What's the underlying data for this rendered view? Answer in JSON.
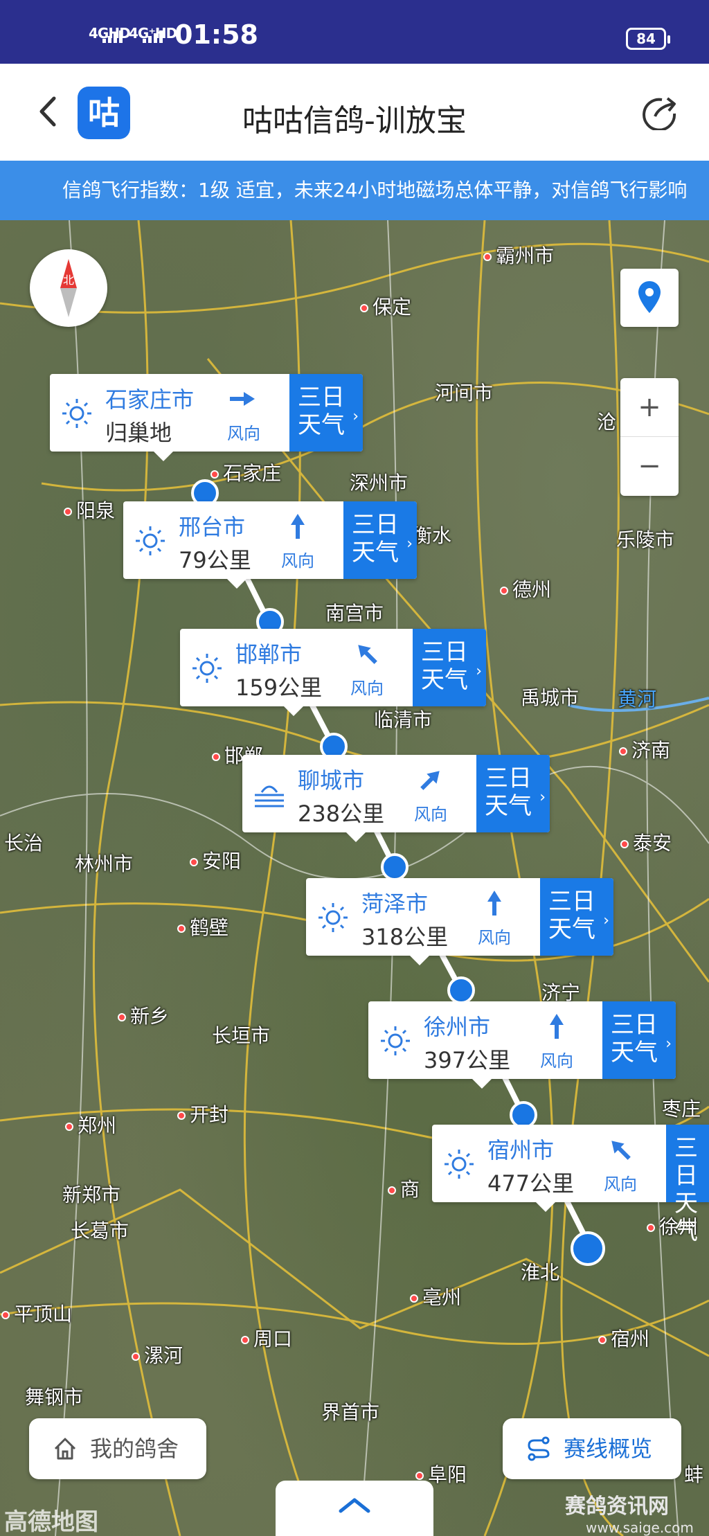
{
  "status_bar": {
    "signal1": "4GHD",
    "signal2": "4G⁺HD",
    "time": "01:58",
    "battery": "84"
  },
  "header": {
    "logo_char": "咕",
    "title": "咕咕信鸽-训放宝"
  },
  "banner": {
    "text": "信鸽飞行指数：1级 适宜，未来24小时地磁场总体平静，对信鸽飞行影响"
  },
  "map": {
    "compass_label": "北",
    "zoom_in": "+",
    "zoom_out": "−",
    "cities": [
      "霸州市",
      "保定",
      "河间市",
      "沧",
      "石家庄",
      "深州市",
      "阳泉",
      "衡水",
      "乐陵市",
      "德州",
      "南宫市",
      "禹城市",
      "黄河",
      "临清市",
      "济南",
      "邯郸",
      "长治",
      "林州市",
      "安阳",
      "泰安",
      "鹤壁",
      "济宁",
      "新乡",
      "长垣市",
      "郑州",
      "开封",
      "枣庄",
      "新郑市",
      "商",
      "长葛市",
      "淮北",
      "徐州",
      "亳州",
      "平顶山",
      "周口",
      "宿州",
      "漯河",
      "舞钢市",
      "界首市",
      "阜阳",
      "蚌"
    ],
    "watermark": "高德地图"
  },
  "route": [
    {
      "icon": "sunny-icon",
      "name": "石家庄市",
      "dist": "归巢地",
      "wind": "风向",
      "btn1": "三日",
      "btn2": "天气"
    },
    {
      "icon": "sunny-icon",
      "name": "邢台市",
      "dist": "79公里",
      "wind": "风向",
      "btn1": "三日",
      "btn2": "天气"
    },
    {
      "icon": "sunny-icon",
      "name": "邯郸市",
      "dist": "159公里",
      "wind": "风向",
      "btn1": "三日",
      "btn2": "天气"
    },
    {
      "icon": "haze-icon",
      "name": "聊城市",
      "dist": "238公里",
      "wind": "风向",
      "btn1": "三日",
      "btn2": "天气"
    },
    {
      "icon": "sunny-icon",
      "name": "菏泽市",
      "dist": "318公里",
      "wind": "风向",
      "btn1": "三日",
      "btn2": "天气"
    },
    {
      "icon": "sunny-icon",
      "name": "徐州市",
      "dist": "397公里",
      "wind": "风向",
      "btn1": "三日",
      "btn2": "天气"
    },
    {
      "icon": "sunny-icon",
      "name": "宿州市",
      "dist": "477公里",
      "wind": "风向",
      "btn1": "三日",
      "btn2": "天气"
    }
  ],
  "bottom": {
    "loft_label": "我的鸽舍",
    "overview_label": "赛线概览"
  },
  "site_watermark": {
    "line1": "赛鸽资讯网",
    "line2": "www.saige.com"
  },
  "colors": {
    "status_bar": "#2b2f8e",
    "banner": "#3b8ee8",
    "accent": "#1a7ae6"
  }
}
